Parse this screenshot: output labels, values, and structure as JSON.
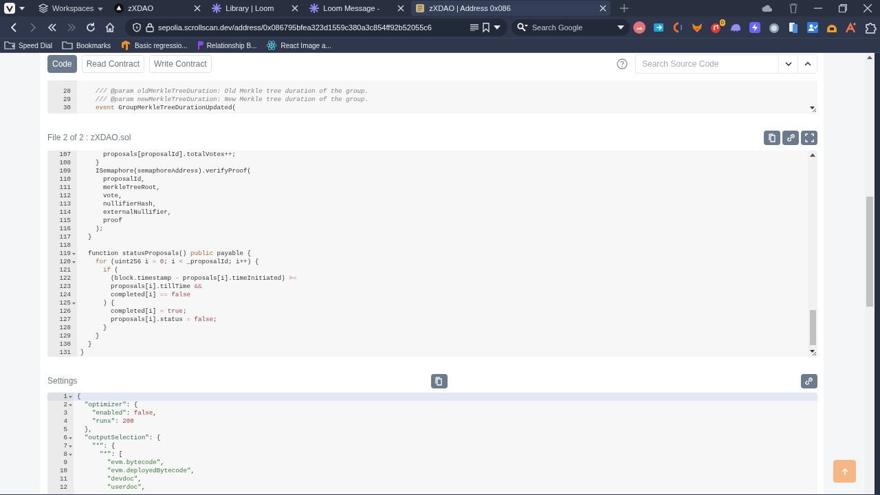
{
  "browser": {
    "workspaces": "Workspaces",
    "tabs": [
      {
        "title": "zXDAO",
        "selected": false
      },
      {
        "title": "Library | Loom",
        "selected": false
      },
      {
        "title": "Loom Message -",
        "selected": false
      },
      {
        "title": "zXDAO | Address 0x086",
        "selected": true
      }
    ],
    "address": "sepolia.scrollscan.dev/address/0x086795bfea323d1559c380a3c854ff92b52055c6",
    "search": {
      "placeholder": "Search Google"
    },
    "extension_badge": "0",
    "bookmarks": [
      "Speed Dial",
      "Bookmarks",
      "Basic regressio...",
      "Relationship B...",
      "React Image a..."
    ]
  },
  "page": {
    "tabs": [
      {
        "label": "Code",
        "selected": true
      },
      {
        "label": "Read Contract",
        "selected": false
      },
      {
        "label": "Write Contract",
        "selected": false
      }
    ],
    "source_search": {
      "placeholder": "Search Source Code"
    },
    "file_1_excerpt": {
      "lines": [
        {
          "number": "28",
          "fold": false,
          "segments": [
            {
              "kind": "comment",
              "text": "    /// @param oldMerkleTreeDuration: Old Merkle tree duration of the group."
            }
          ]
        },
        {
          "number": "29",
          "fold": false,
          "segments": [
            {
              "kind": "comment",
              "text": "    /// @param newMerkleTreeDuration: New Merkle tree duration of the group."
            }
          ]
        },
        {
          "number": "30",
          "fold": false,
          "segments": [
            {
              "kind": "keyword",
              "text": "    event"
            },
            {
              "kind": "plain",
              "text": " GroupMerkleTreeDurationUpdated("
            }
          ]
        }
      ]
    },
    "file_2": {
      "title": "File 2 of 2 : zXDAO.sol",
      "lines": [
        {
          "number": "107",
          "fold": false,
          "segments": [
            {
              "kind": "plain",
              "text": "      proposals[proposalId].totalVotes++;"
            }
          ]
        },
        {
          "number": "108",
          "fold": false,
          "segments": [
            {
              "kind": "plain",
              "text": "    }"
            }
          ]
        },
        {
          "number": "109",
          "fold": false,
          "segments": [
            {
              "kind": "plain",
              "text": "    ISemaphore(semaphoreAddress).verifyProof("
            }
          ]
        },
        {
          "number": "110",
          "fold": false,
          "segments": [
            {
              "kind": "plain",
              "text": "      proposalId,"
            }
          ]
        },
        {
          "number": "111",
          "fold": false,
          "segments": [
            {
              "kind": "plain",
              "text": "      merkleTreeRoot,"
            }
          ]
        },
        {
          "number": "112",
          "fold": false,
          "segments": [
            {
              "kind": "plain",
              "text": "      vote,"
            }
          ]
        },
        {
          "number": "113",
          "fold": false,
          "segments": [
            {
              "kind": "plain",
              "text": "      nullifierHash,"
            }
          ]
        },
        {
          "number": "114",
          "fold": false,
          "segments": [
            {
              "kind": "plain",
              "text": "      externalNullifier,"
            }
          ]
        },
        {
          "number": "115",
          "fold": false,
          "segments": [
            {
              "kind": "plain",
              "text": "      proof"
            }
          ]
        },
        {
          "number": "116",
          "fold": false,
          "segments": [
            {
              "kind": "plain",
              "text": "    );"
            }
          ]
        },
        {
          "number": "117",
          "fold": false,
          "segments": [
            {
              "kind": "plain",
              "text": "  }"
            }
          ]
        },
        {
          "number": "118",
          "fold": false
        },
        {
          "number": "119",
          "fold": true,
          "segments": [
            {
              "kind": "plain",
              "text": "  function statusProposals() "
            },
            {
              "kind": "keyword",
              "text": "public"
            },
            {
              "kind": "plain",
              "text": " payable {"
            }
          ]
        },
        {
          "number": "120",
          "fold": true,
          "segments": [
            {
              "kind": "keyword",
              "text": "    for"
            },
            {
              "kind": "plain",
              "text": " (uint256 i "
            },
            {
              "kind": "operator",
              "text": "="
            },
            {
              "kind": "number",
              "text": " 0"
            },
            {
              "kind": "plain",
              "text": "; i "
            },
            {
              "kind": "operator",
              "text": "<"
            },
            {
              "kind": "plain",
              "text": " _proposalId; i++) {"
            }
          ]
        },
        {
          "number": "121",
          "fold": false,
          "segments": [
            {
              "kind": "keyword",
              "text": "      if"
            },
            {
              "kind": "plain",
              "text": " ("
            }
          ]
        },
        {
          "number": "122",
          "fold": false,
          "segments": [
            {
              "kind": "plain",
              "text": "        (block.timestamp "
            },
            {
              "kind": "operator",
              "text": "-"
            },
            {
              "kind": "plain",
              "text": " proposals[i].timeInitiated) "
            },
            {
              "kind": "operator",
              "text": ">="
            }
          ]
        },
        {
          "number": "123",
          "fold": false,
          "segments": [
            {
              "kind": "plain",
              "text": "        proposals[i].tillTime "
            },
            {
              "kind": "operator",
              "text": "&&"
            }
          ]
        },
        {
          "number": "124",
          "fold": false,
          "segments": [
            {
              "kind": "plain",
              "text": "        completed[i] "
            },
            {
              "kind": "operator",
              "text": "=="
            },
            {
              "kind": "constant",
              "text": " false"
            }
          ]
        },
        {
          "number": "125",
          "fold": true,
          "segments": [
            {
              "kind": "plain",
              "text": "      ) {"
            }
          ]
        },
        {
          "number": "126",
          "fold": false,
          "segments": [
            {
              "kind": "plain",
              "text": "        completed[i] "
            },
            {
              "kind": "operator",
              "text": "="
            },
            {
              "kind": "constant",
              "text": " true"
            },
            {
              "kind": "plain",
              "text": ";"
            }
          ]
        },
        {
          "number": "127",
          "fold": false,
          "segments": [
            {
              "kind": "plain",
              "text": "        proposals[i].status "
            },
            {
              "kind": "operator",
              "text": "="
            },
            {
              "kind": "constant",
              "text": " false"
            },
            {
              "kind": "plain",
              "text": ";"
            }
          ]
        },
        {
          "number": "128",
          "fold": false,
          "segments": [
            {
              "kind": "plain",
              "text": "      }"
            }
          ]
        },
        {
          "number": "129",
          "fold": false,
          "segments": [
            {
              "kind": "plain",
              "text": "    }"
            }
          ]
        },
        {
          "number": "130",
          "fold": false,
          "segments": [
            {
              "kind": "plain",
              "text": "  }"
            }
          ]
        },
        {
          "number": "131",
          "fold": false,
          "segments": [
            {
              "kind": "plain",
              "text": "}"
            }
          ]
        }
      ]
    },
    "settings": {
      "title": "Settings",
      "lines": [
        {
          "number": "1",
          "fold": true,
          "active": true,
          "segments": [
            {
              "kind": "plain",
              "text": "{"
            }
          ]
        },
        {
          "number": "2",
          "fold": true,
          "active": false,
          "segments": [
            {
              "kind": "key",
              "text": "  \"optimizer\""
            },
            {
              "kind": "plain",
              "text": ": {"
            }
          ]
        },
        {
          "number": "3",
          "fold": false,
          "active": false,
          "segments": [
            {
              "kind": "key",
              "text": "    \"enabled\""
            },
            {
              "kind": "plain",
              "text": ": "
            },
            {
              "kind": "constant",
              "text": "false"
            },
            {
              "kind": "plain",
              "text": ","
            }
          ]
        },
        {
          "number": "4",
          "fold": false,
          "active": false,
          "segments": [
            {
              "kind": "key",
              "text": "    \"runs\""
            },
            {
              "kind": "plain",
              "text": ": "
            },
            {
              "kind": "number",
              "text": "200"
            }
          ]
        },
        {
          "number": "5",
          "fold": false,
          "active": false,
          "segments": [
            {
              "kind": "plain",
              "text": "  },"
            }
          ]
        },
        {
          "number": "6",
          "fold": true,
          "active": false,
          "segments": [
            {
              "kind": "key",
              "text": "  \"outputSelection\""
            },
            {
              "kind": "plain",
              "text": ": {"
            }
          ]
        },
        {
          "number": "7",
          "fold": true,
          "active": false,
          "segments": [
            {
              "kind": "key",
              "text": "    \"*\""
            },
            {
              "kind": "plain",
              "text": ": {"
            }
          ]
        },
        {
          "number": "8",
          "fold": true,
          "active": false,
          "segments": [
            {
              "kind": "key",
              "text": "      \"*\""
            },
            {
              "kind": "plain",
              "text": ": ["
            }
          ]
        },
        {
          "number": "9",
          "fold": false,
          "active": false,
          "segments": [
            {
              "kind": "string",
              "text": "        \"evm.bytecode\""
            },
            {
              "kind": "plain",
              "text": ","
            }
          ]
        },
        {
          "number": "10",
          "fold": false,
          "active": false,
          "segments": [
            {
              "kind": "string",
              "text": "        \"evm.deployedBytecode\""
            },
            {
              "kind": "plain",
              "text": ","
            }
          ]
        },
        {
          "number": "11",
          "fold": false,
          "active": false,
          "segments": [
            {
              "kind": "string",
              "text": "        \"devdoc\""
            },
            {
              "kind": "plain",
              "text": ","
            }
          ]
        },
        {
          "number": "12",
          "fold": false,
          "active": false,
          "segments": [
            {
              "kind": "string",
              "text": "        \"userdoc\""
            },
            {
              "kind": "plain",
              "text": ","
            }
          ]
        }
      ]
    }
  }
}
